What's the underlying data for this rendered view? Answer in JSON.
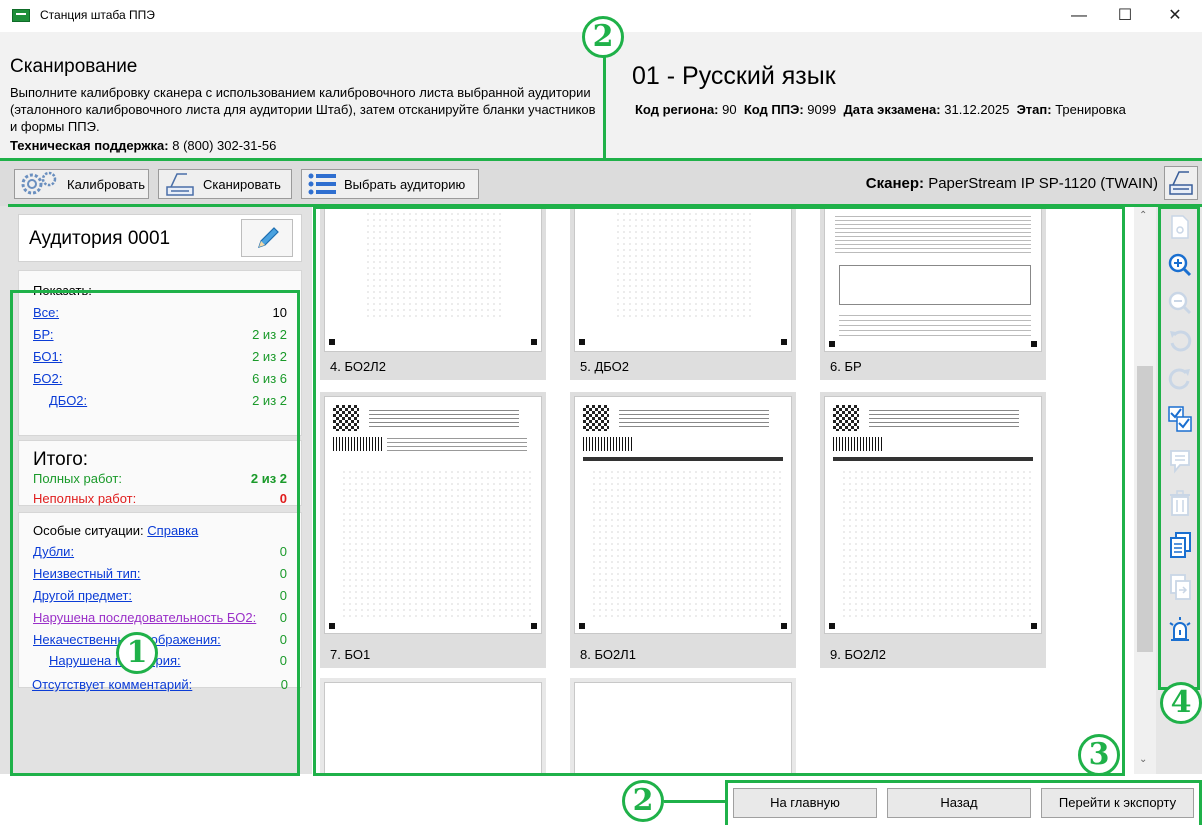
{
  "window": {
    "title": "Станция штаба ППЭ",
    "minimize": "—",
    "maximize": "☐",
    "close": "✕"
  },
  "header": {
    "title": "Сканирование",
    "description": "Выполните калибровку сканера с использованием калибровочного листа выбранной аудитории (эталонного калибровочного листа для аудитории Штаб), затем отсканируйте бланки участников и формы ППЭ.",
    "support_label": "Техническая поддержка:",
    "support_phone": "8 (800) 302-31-56",
    "subject": "01 - Русский язык",
    "region_label": "Код региона:",
    "region": "90",
    "ppe_label": "Код ППЭ:",
    "ppe": "9099",
    "date_label": "Дата экзамена:",
    "date": "31.12.2025",
    "stage_label": "Этап:",
    "stage": "Тренировка"
  },
  "toolbar": {
    "calibrate": "Калибровать",
    "scan": "Сканировать",
    "select_room": "Выбрать аудиторию",
    "scanner_label": "Сканер:",
    "scanner_name": "PaperStream IP SP-1120 (TWAIN)"
  },
  "left": {
    "room": "Аудитория 0001",
    "show_label": "Показать:",
    "filters": [
      {
        "label": "Все:",
        "value": "10"
      },
      {
        "label": "БР:",
        "value": "2 из 2"
      },
      {
        "label": "БО1:",
        "value": "2 из 2"
      },
      {
        "label": "БО2:",
        "value": "6 из 6"
      },
      {
        "label": "ДБО2:",
        "value": "2 из 2"
      }
    ],
    "total_title": "Итого:",
    "complete_label": "Полных работ:",
    "complete_value": "2 из 2",
    "incomplete_label": "Неполных работ:",
    "incomplete_value": "0",
    "special_label": "Особые ситуации:",
    "help_link": "Справка",
    "special": [
      {
        "label": "Дубли:",
        "value": "0"
      },
      {
        "label": "Неизвестный тип:",
        "value": "0"
      },
      {
        "label": "Другой предмет:",
        "value": "0"
      },
      {
        "label": "Нарушена последовательность БО2:",
        "value": "0"
      },
      {
        "label": "Некачественные изображения:",
        "value": "0"
      },
      {
        "label": "Нарушена геометрия:",
        "value": "0"
      },
      {
        "label": "Отсутствует комментарий:",
        "value": "0"
      }
    ]
  },
  "thumbnails": [
    {
      "caption": "4. БО2Л2"
    },
    {
      "caption": "5. ДБО2"
    },
    {
      "caption": "6. БР"
    },
    {
      "caption": "7. БО1"
    },
    {
      "caption": "8. БО2Л1"
    },
    {
      "caption": "9. БО2Л2"
    }
  ],
  "right_tools": [
    "view-icon",
    "zoom-in-icon",
    "zoom-out-icon",
    "rotate-left-icon",
    "rotate-right-icon",
    "check-icon",
    "comment-icon",
    "delete-icon",
    "copy-icon",
    "export-icon",
    "alert-icon"
  ],
  "bottom": {
    "home": "На главную",
    "back": "Назад",
    "export": "Перейти к экспорту"
  },
  "annotations": {
    "c1": "1",
    "c2a": "2",
    "c2b": "2",
    "c3": "3",
    "c4": "4"
  },
  "colors": {
    "annotation": "#1fb149",
    "link": "#0b3cd6",
    "ok": "#1a9a2a",
    "error": "#e01c1c"
  }
}
